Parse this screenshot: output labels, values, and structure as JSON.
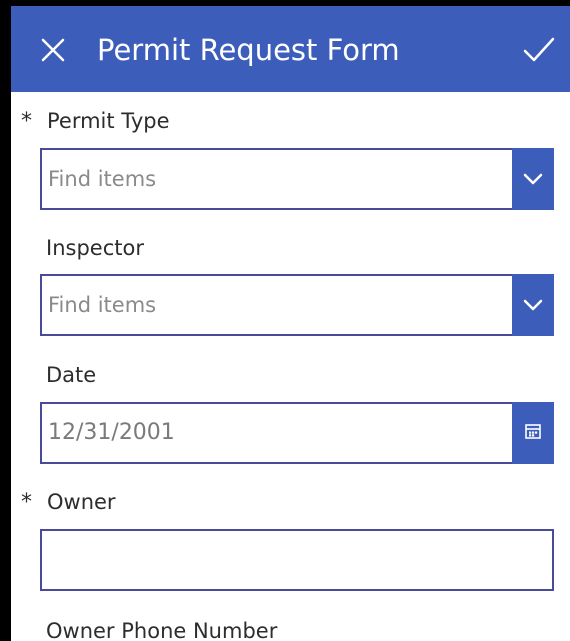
{
  "header": {
    "title": "Permit Request Form",
    "close_icon": "close-icon",
    "submit_icon": "checkmark-icon"
  },
  "colors": {
    "header_bg": "#3c5dba",
    "input_border": "#4a4a9a",
    "button_bg": "#3c5dba"
  },
  "fields": {
    "permit_type": {
      "required_mark": "*",
      "label": "Permit Type",
      "placeholder": "Find items",
      "button_icon": "chevron-down-icon"
    },
    "inspector": {
      "label": "Inspector",
      "placeholder": "Find items",
      "button_icon": "chevron-down-icon"
    },
    "date": {
      "label": "Date",
      "value": "12/31/2001",
      "button_icon": "calendar-icon"
    },
    "owner": {
      "required_mark": "*",
      "label": "Owner",
      "value": ""
    },
    "owner_phone": {
      "label": "Owner Phone Number"
    }
  }
}
